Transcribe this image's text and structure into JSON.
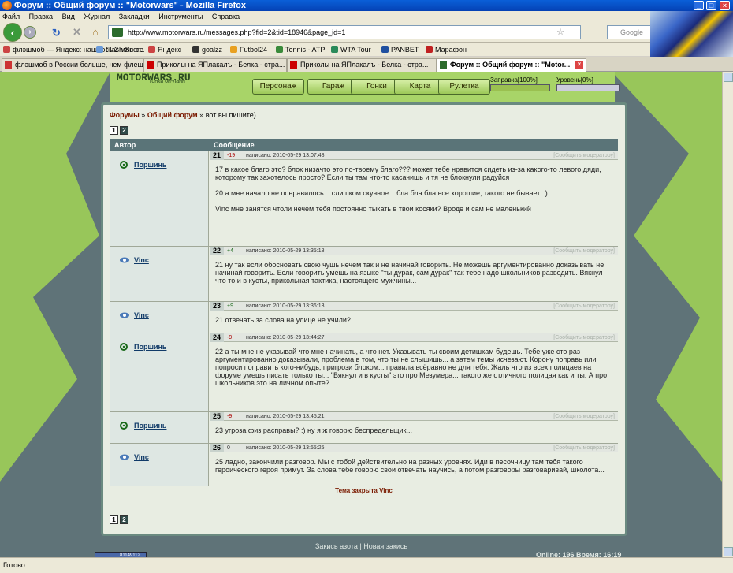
{
  "window": {
    "title": "Форум :: Общий форум :: \"Motorwars\" - Mozilla Firefox"
  },
  "menu": [
    "Файл",
    "Правка",
    "Вид",
    "Журнал",
    "Закладки",
    "Инструменты",
    "Справка"
  ],
  "nav": {
    "url": "http://www.motorwars.ru/messages.php?fid=2&tid=18946&page_id=1",
    "search_placeholder": "Google"
  },
  "bookmarks": [
    "флэшмоб — Яндекс: нашлось 2 млн с...",
    "Flash Score",
    "Яндекс",
    "goalzz",
    "Futbol24",
    "Tennis - ATP",
    "WTA Tour",
    "PANBET",
    "Марафон"
  ],
  "tabs": [
    {
      "label": "флэшмоб в России больше, чем флеш..."
    },
    {
      "label": "Приколы на ЯПлакалъ - Белка - стра..."
    },
    {
      "label": "Форум :: Общий форум :: \"Motor...",
      "active": true
    }
  ],
  "site": {
    "logo": "MOTORWARS.RU",
    "logo_sub": "гонки он-лайн",
    "menu": [
      "Персонаж",
      "Гараж",
      "Гонки",
      "Карта",
      "Рулетка"
    ],
    "fuel_label": "Заправка[100%]",
    "fuel_pct": 100,
    "level_label": "Уровень[0%]",
    "level_pct": 0
  },
  "forum": {
    "breadcrumb": {
      "forums": "Форумы",
      "sep1": " » ",
      "section": "Общий форум",
      "sep2": " » ",
      "topic": "вот вы пишите)"
    },
    "pages": [
      "1",
      "2"
    ],
    "col_author": "Автор",
    "col_message": "Сообщение",
    "report_label": "[Сообщить модератору]",
    "posts": [
      {
        "num": "21",
        "rating": "-19",
        "date": "написано: 2010-05-29 13:07:48",
        "author": "Поршинь",
        "paragraphs": [
          "17 в какое благо это? блок низачто это по-твоему благо??? может тебе нравится сидеть из-за какого-то левого дяди, которому так захотелось просто? Если ты там что-то касачишь и тя не блокнули радуйся",
          "20 а мне начало не понравилось... слишком скучное... бла бла бла все хорошие, такого не бывает...)",
          "Vinc мне занятся чтоли нечем тебя постоянно тыкать в твои косяки? Вроде и сам не маленький"
        ]
      },
      {
        "num": "22",
        "rating": "+4",
        "date": "написано: 2010-05-29 13:35:18",
        "author": "Vinc",
        "paragraphs": [
          "21 ну так если обосновать свою чушь нечем так и не начинай говорить. Не можешь аргументированно доказывать не начинай говорить. Если говорить умешь на языке \"ты дурак, сам дурак\" так тебе надо школьников разводить. Вякнул что то и в кусты, прикольная тактика, настоящего мужчины..."
        ]
      },
      {
        "num": "23",
        "rating": "+9",
        "date": "написано: 2010-05-29 13:36:13",
        "author": "Vinc",
        "paragraphs": [
          "21 отвечать за слова на улице не учили?"
        ]
      },
      {
        "num": "24",
        "rating": "-9",
        "date": "написано: 2010-05-29 13:44:27",
        "author": "Поршинь",
        "paragraphs": [
          "22 а ты мне не указывай что мне начинать, а что нет. Указывать ты своим детишкам будешь. Тебе уже сто раз аргументированно доказывали, проблема в том, что ты не слышишь... а затем темы исчезают. Корону поправь или попроси поправить кого-нибудь, пригрози блоком... правила всёравно не для тебя. Жаль что из всех полицаев на форуме умешь писать только ты... \"Вякнул и в кусты\" это про Мезумера... такого же отличного полицая как и ты. А про школьников это на личном опыте?"
        ]
      },
      {
        "num": "25",
        "rating": "-9",
        "date": "написано: 2010-05-29 13:45:21",
        "author": "Поршинь",
        "paragraphs": [
          "23 угроза физ расправы? :) ну я ж говорю беспредельщик..."
        ]
      },
      {
        "num": "26",
        "rating": "0",
        "date": "написано: 2010-05-29 13:55:25",
        "author": "Vinc",
        "paragraphs": [
          "25 ладно, закончили разговор. Мы с тобой действительно на разных уровнях. Иди в песочницу там тебя такого героического героя примут. За слова тебе говорю свои отвечать научись, а потом разговоры разговаривай, школота..."
        ]
      }
    ],
    "closed": "Тема закрыта Vinc"
  },
  "footer": {
    "link1": "Закись азота",
    "sep": " | ",
    "link2": "Новая закись",
    "online": "Online: 196  Время: 16:19",
    "counter_num": "81149112"
  },
  "status": "Готово",
  "colors": {
    "title_blue": "#0542b5",
    "header_green": "#9fcf56",
    "table_head": "#5a7478",
    "link_red": "#7a1a00"
  }
}
